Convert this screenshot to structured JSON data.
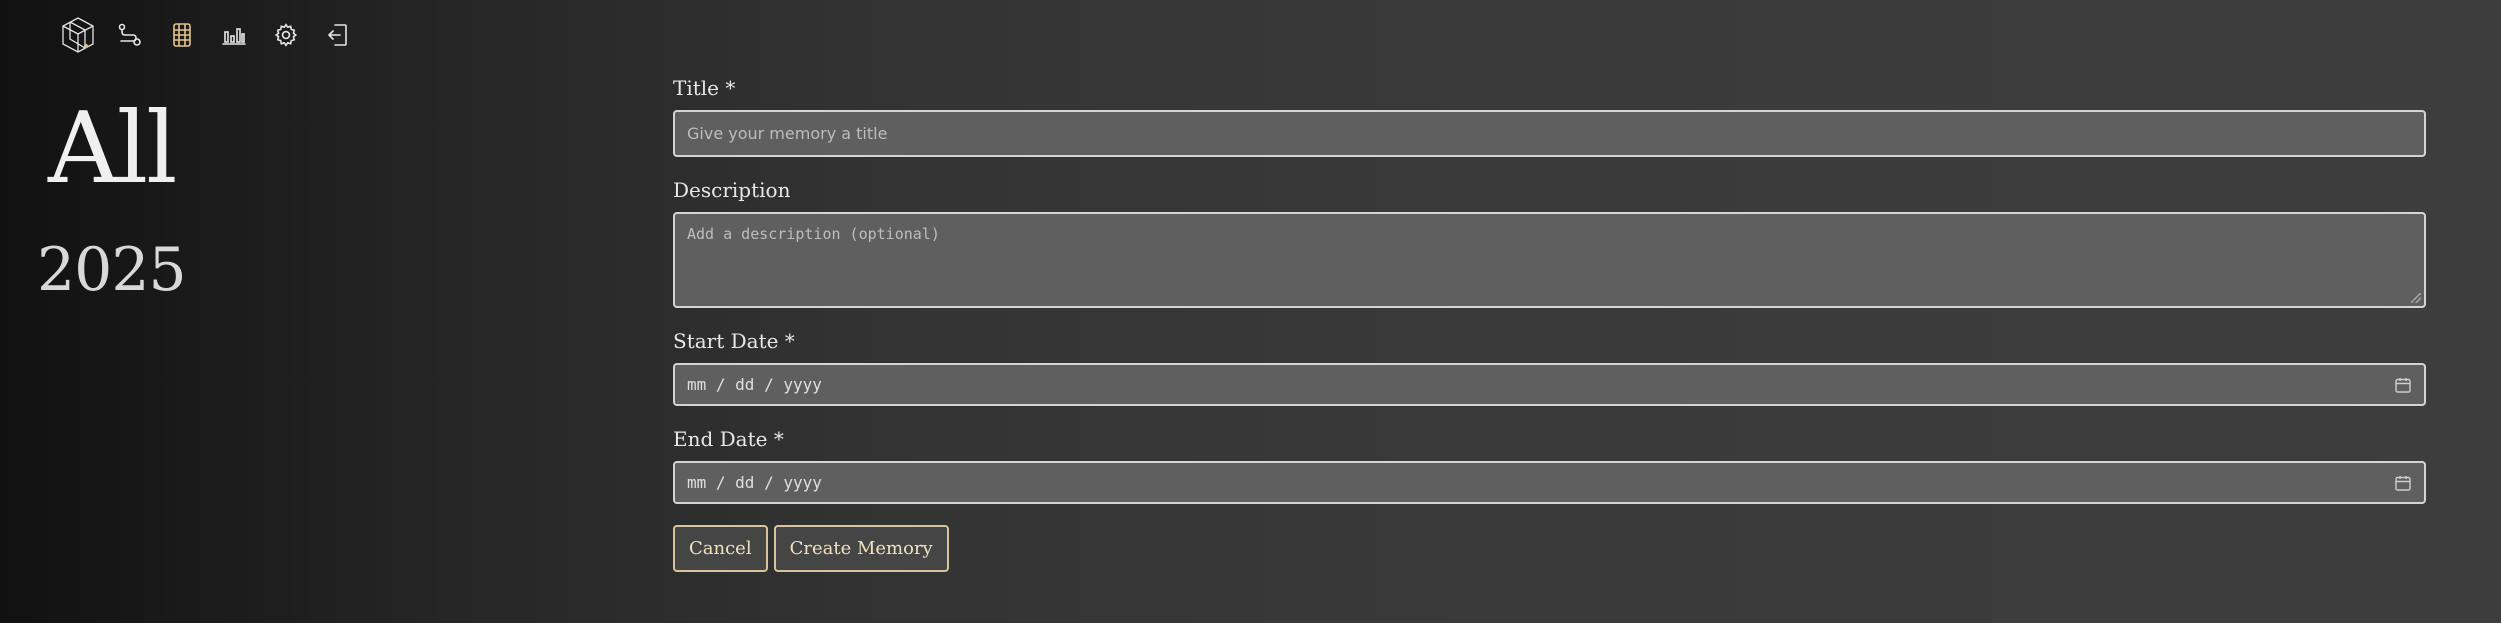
{
  "nav": {
    "items": [
      {
        "name": "logo-cube-icon"
      },
      {
        "name": "journey-path-icon"
      },
      {
        "name": "film-strip-icon"
      },
      {
        "name": "stats-chart-icon"
      },
      {
        "name": "settings-gear-icon"
      },
      {
        "name": "logout-icon"
      }
    ]
  },
  "hero": {
    "title": "All",
    "year": "2025"
  },
  "form": {
    "title": {
      "label": "Title *",
      "placeholder": "Give your memory a title"
    },
    "description": {
      "label": "Description",
      "placeholder": "Add a description (optional)"
    },
    "start_date": {
      "label": "Start Date *",
      "value": "mm / dd / yyyy"
    },
    "end_date": {
      "label": "End Date *",
      "value": "mm / dd / yyyy"
    }
  },
  "buttons": {
    "cancel": "Cancel",
    "create": "Create Memory"
  },
  "colors": {
    "accent": "#d8c49a",
    "field_bg": "#5f5f5f",
    "field_border": "#d4d4d4"
  }
}
